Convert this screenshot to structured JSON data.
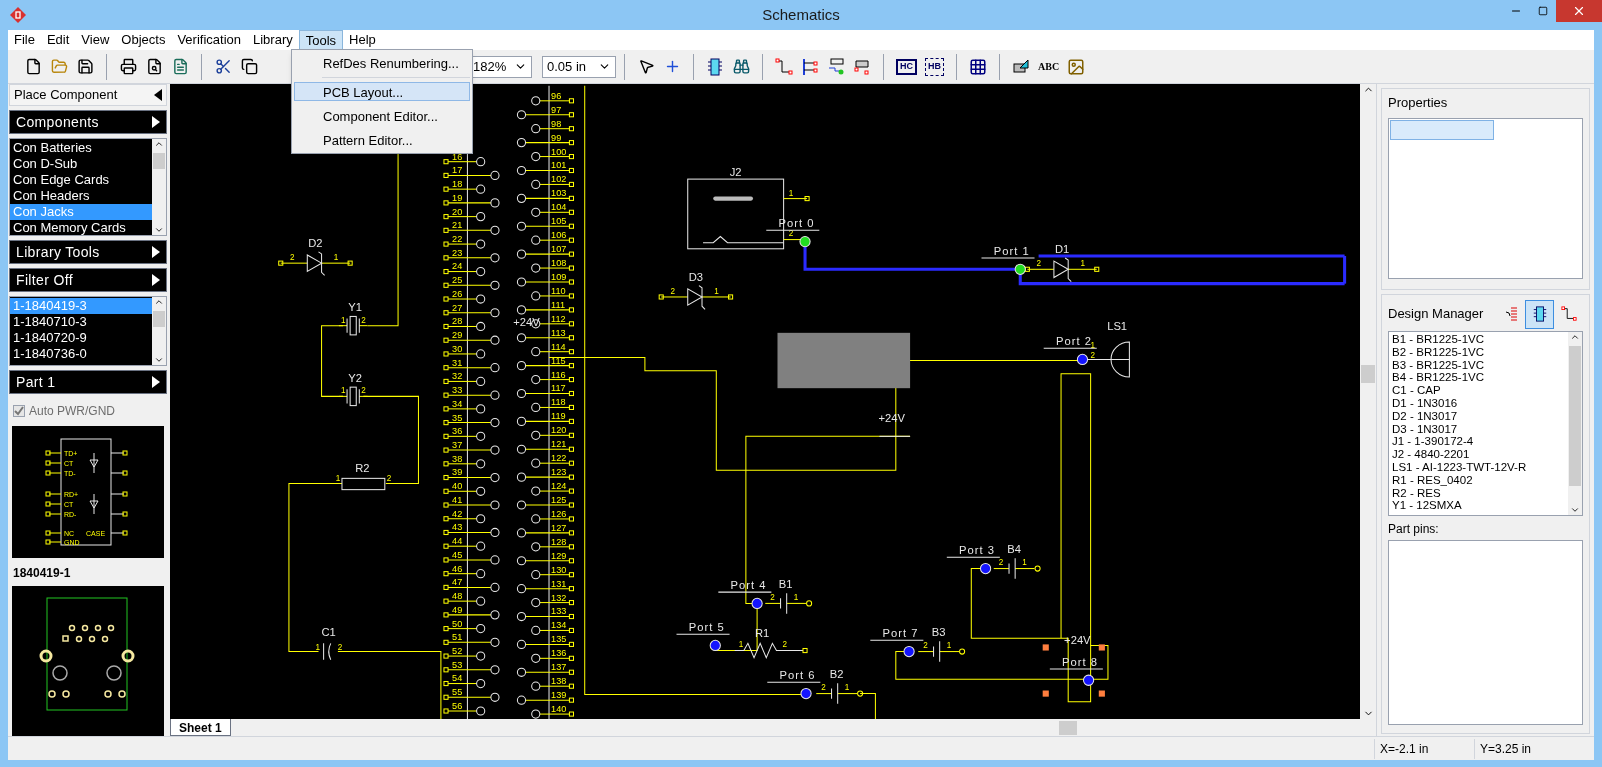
{
  "window": {
    "title": "Schematics"
  },
  "menu": [
    {
      "label": "File",
      "selected": false
    },
    {
      "label": "Edit",
      "selected": false
    },
    {
      "label": "View",
      "selected": false
    },
    {
      "label": "Objects",
      "selected": false
    },
    {
      "label": "Verification",
      "selected": false
    },
    {
      "label": "Library",
      "selected": false
    },
    {
      "label": "Tools",
      "selected": true
    },
    {
      "label": "Help",
      "selected": false
    }
  ],
  "dropdown_menu": {
    "items": [
      {
        "kind": "item",
        "label": "RefDes Renumbering...",
        "highlighted": false
      },
      {
        "kind": "separator"
      },
      {
        "kind": "item",
        "label": "PCB Layout...",
        "highlighted": true
      },
      {
        "kind": "item",
        "label": "Component Editor...",
        "highlighted": false
      },
      {
        "kind": "item",
        "label": "Pattern Editor...",
        "highlighted": false
      }
    ]
  },
  "toolbar": {
    "zoom": "182%",
    "grid_step": "0.05 in",
    "module_labels": [
      "HC",
      "HB"
    ],
    "text_tool": "ABC"
  },
  "left_panel": {
    "place_component": "Place Component",
    "components": {
      "title": "Components",
      "items": [
        {
          "label": "Con Batteries",
          "selected": false
        },
        {
          "label": "Con D-Sub",
          "selected": false
        },
        {
          "label": "Con Edge Cards",
          "selected": false
        },
        {
          "label": "Con Headers",
          "selected": false
        },
        {
          "label": "Con Jacks",
          "selected": true
        },
        {
          "label": "Con Memory Cards",
          "selected": false
        }
      ]
    },
    "library_tools": "Library Tools",
    "filter": "Filter Off",
    "parts": [
      {
        "label": "1-1840419-3",
        "selected": true
      },
      {
        "label": "1-1840710-3",
        "selected": false
      },
      {
        "label": "1-1840720-9",
        "selected": false
      },
      {
        "label": "1-1840736-0",
        "selected": false
      }
    ],
    "part": "Part 1",
    "auto_pwr_gnd": {
      "label": "Auto PWR/GND",
      "checked": true,
      "disabled": true
    },
    "symbol_preview": {
      "left_pins": [
        "TD+",
        "CT",
        "TD-",
        "RD+",
        "CT",
        "RD-",
        "NC",
        "GND"
      ],
      "right_pin": "CASE"
    },
    "pattern_name": "1840419-1"
  },
  "schematic": {
    "connector_left_pins": [
      "16",
      "17",
      "18",
      "19",
      "20",
      "21",
      "22",
      "23",
      "24",
      "25",
      "26",
      "27",
      "28",
      "29",
      "30",
      "31",
      "32",
      "33",
      "34",
      "35",
      "36",
      "37",
      "38",
      "39",
      "40",
      "41",
      "42",
      "43",
      "44",
      "45",
      "46",
      "47",
      "48",
      "49",
      "50",
      "51",
      "52",
      "53",
      "54",
      "55",
      "56"
    ],
    "connector_right_pins": [
      "96",
      "97",
      "98",
      "99",
      "100",
      "101",
      "102",
      "103",
      "104",
      "105",
      "106",
      "107",
      "108",
      "109",
      "110",
      "111",
      "112",
      "113",
      "114",
      "115",
      "116",
      "117",
      "118",
      "119",
      "120",
      "121",
      "122",
      "123",
      "124",
      "125",
      "126",
      "127",
      "128",
      "129",
      "130",
      "131",
      "132",
      "133",
      "134",
      "135",
      "136",
      "137",
      "138",
      "139",
      "140"
    ],
    "parts": [
      {
        "kind": "diode",
        "ref": "D2",
        "pins": [
          "2",
          "1"
        ]
      },
      {
        "kind": "crystal",
        "ref": "Y1",
        "pins": [
          "1",
          "2"
        ]
      },
      {
        "kind": "crystal",
        "ref": "Y2",
        "pins": [
          "1",
          "2"
        ]
      },
      {
        "kind": "resistor",
        "ref": "R2",
        "pins": [
          "1",
          "2"
        ]
      },
      {
        "kind": "capacitor",
        "ref": "C1",
        "pins": [
          "1",
          "2"
        ]
      },
      {
        "kind": "jack",
        "ref": "J2",
        "pins": [
          "1",
          "2"
        ]
      },
      {
        "kind": "diode",
        "ref": "D3",
        "pins": [
          "2",
          "1"
        ]
      },
      {
        "kind": "diode",
        "ref": "D1",
        "pins": [
          "2",
          "1"
        ]
      },
      {
        "kind": "speaker",
        "ref": "LS1",
        "pins": [
          "1",
          "2"
        ]
      },
      {
        "kind": "battery",
        "ref": "B4",
        "pins": [
          "2",
          "1"
        ]
      },
      {
        "kind": "battery",
        "ref": "B1",
        "pins": [
          "2",
          "1"
        ]
      },
      {
        "kind": "zigzag",
        "ref": "R1",
        "pins": [
          "1",
          "2"
        ]
      },
      {
        "kind": "battery",
        "ref": "B3",
        "pins": [
          "2",
          "1"
        ]
      },
      {
        "kind": "battery",
        "ref": "B2",
        "pins": [
          "2",
          "1"
        ]
      }
    ],
    "ports": [
      {
        "label": "Port 0",
        "selected": true
      },
      {
        "label": "Port 1",
        "selected": true
      },
      {
        "label": "Port 2",
        "selected": false
      },
      {
        "label": "Port 3",
        "selected": false
      },
      {
        "label": "Port 4",
        "selected": false
      },
      {
        "label": "Port 5",
        "selected": false
      },
      {
        "label": "Port 6",
        "selected": false
      },
      {
        "label": "Port 7",
        "selected": false
      },
      {
        "label": "Port 8",
        "selected": false
      }
    ],
    "power_labels": [
      "+24V",
      "+24V",
      "+24V"
    ]
  },
  "sheet_tabs": [
    {
      "label": "Sheet 1",
      "selected": true
    }
  ],
  "right_panel": {
    "properties": "Properties",
    "design_manager": "Design Manager",
    "view_buttons": [
      {
        "selected": false
      },
      {
        "selected": true
      },
      {
        "selected": false
      }
    ],
    "items": [
      "B1 - BR1225-1VC",
      "B2 - BR1225-1VC",
      "B3 - BR1225-1VC",
      "B4 - BR1225-1VC",
      "C1 - CAP",
      "D1 - 1N3016",
      "D2 - 1N3017",
      "D3 - 1N3017",
      "J1 - 1-390172-4",
      "J2 - 4840-2201",
      "LS1 - AI-1223-TWT-12V-R",
      "R1 - RES_0402",
      "R2 - RES",
      "Y1 - 12SMXA"
    ],
    "part_pins": "Part pins:"
  },
  "status_bar": [
    "X=-2.1 in",
    "Y=3.25 in"
  ]
}
